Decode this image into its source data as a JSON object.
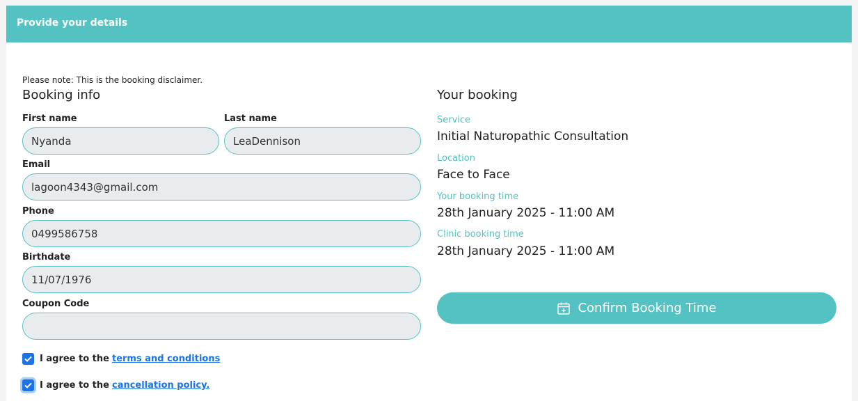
{
  "header": {
    "title": "Provide your details"
  },
  "disclaimer": "Please note: This is the booking disclaimer.",
  "booking_info": {
    "title": "Booking info",
    "first_name": {
      "label": "First name",
      "value": "Nyanda"
    },
    "last_name": {
      "label": "Last name",
      "value": "LeaDennison"
    },
    "email": {
      "label": "Email",
      "value": "lagoon4343@gmail.com"
    },
    "phone": {
      "label": "Phone",
      "value": "0499586758"
    },
    "birthdate": {
      "label": "Birthdate",
      "value": "11/07/1976"
    },
    "coupon": {
      "label": "Coupon Code",
      "value": ""
    },
    "terms": {
      "prefix": "I agree to the",
      "link": "terms and conditions",
      "checked": true
    },
    "cancellation": {
      "prefix": "I agree to the",
      "link": "cancellation policy.",
      "checked": true
    }
  },
  "your_booking": {
    "title": "Your booking",
    "service": {
      "label": "Service",
      "value": "Initial Naturopathic Consultation"
    },
    "location": {
      "label": "Location",
      "value": "Face to Face"
    },
    "booking_time": {
      "label": "Your booking time",
      "value": "28th January 2025 - 11:00 AM"
    },
    "clinic_time": {
      "label": "Clinic booking time",
      "value": "28th January 2025 - 11:00 AM"
    },
    "confirm_label": "Confirm Booking Time",
    "confirm_icon": "calendar-plus-icon"
  },
  "colors": {
    "accent": "#54c2c2",
    "link": "#1a73e8",
    "input_bg": "#e8ecee"
  }
}
